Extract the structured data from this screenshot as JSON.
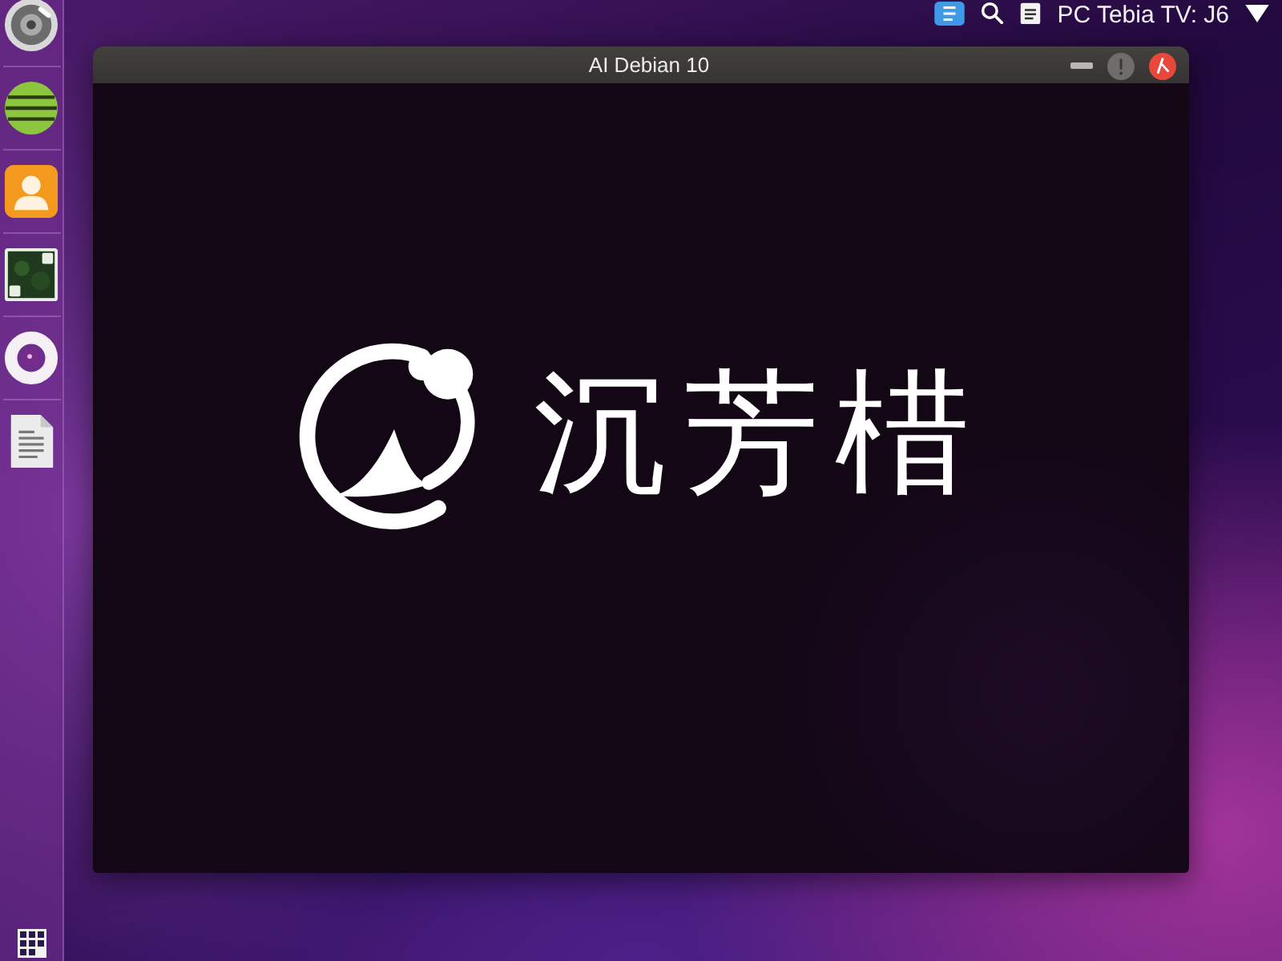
{
  "top_panel": {
    "status_text": "PC Tebia TV: J6"
  },
  "window": {
    "title": "AI Debian 10",
    "content": {
      "logo_text": "沉芳棤"
    }
  }
}
